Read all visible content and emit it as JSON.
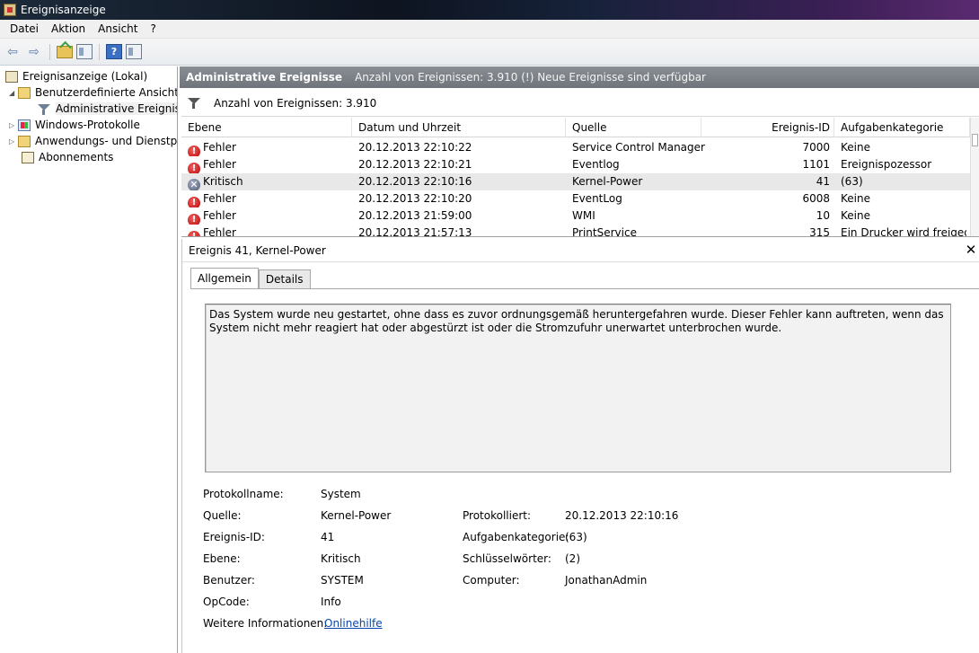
{
  "window": {
    "title": "Ereignisanzeige"
  },
  "menu": [
    "Datei",
    "Aktion",
    "Ansicht",
    "?"
  ],
  "tree": {
    "root": "Ereignisanzeige (Lokal)",
    "custom_views": "Benutzerdefinierte Ansichten",
    "admin_events": "Administrative Ereignisse",
    "windows_logs": "Windows-Protokolle",
    "app_logs": "Anwendungs- und Dienstprotokolle",
    "subscriptions": "Abonnements"
  },
  "header": {
    "title": "Administrative Ereignisse",
    "info": "Anzahl von Ereignissen: 3.910 (!) Neue Ereignisse sind verfügbar"
  },
  "filter": {
    "text": "Anzahl von Ereignissen: 3.910"
  },
  "columns": [
    "Ebene",
    "Datum und Uhrzeit",
    "Quelle",
    "Ereignis-ID",
    "Aufgabenkategorie"
  ],
  "events": [
    {
      "level": "Fehler",
      "icon": "error-icon",
      "datetime": "20.12.2013 22:10:22",
      "source": "Service Control Manager",
      "id": "7000",
      "category": "Keine"
    },
    {
      "level": "Fehler",
      "icon": "error-icon",
      "datetime": "20.12.2013 22:10:21",
      "source": "Eventlog",
      "id": "1101",
      "category": "Ereignispozessor"
    },
    {
      "level": "Kritisch",
      "icon": "critical-icon",
      "datetime": "20.12.2013 22:10:16",
      "source": "Kernel-Power",
      "id": "41",
      "category": "(63)"
    },
    {
      "level": "Fehler",
      "icon": "error-icon",
      "datetime": "20.12.2013 22:10:20",
      "source": "EventLog",
      "id": "6008",
      "category": "Keine"
    },
    {
      "level": "Fehler",
      "icon": "error-icon",
      "datetime": "20.12.2013 21:59:00",
      "source": "WMI",
      "id": "10",
      "category": "Keine"
    },
    {
      "level": "Fehler",
      "icon": "error-icon",
      "datetime": "20.12.2013 21:57:13",
      "source": "PrintService",
      "id": "315",
      "category": "Ein Drucker wird freigeg..."
    }
  ],
  "detail": {
    "title": "Ereignis 41, Kernel-Power",
    "tab_general": "Allgemein",
    "tab_details": "Details",
    "description": "Das System wurde neu gestartet, ohne dass es zuvor ordnungsgemäß heruntergefahren wurde. Dieser Fehler kann auftreten, wenn das System nicht mehr reagiert hat oder abgestürzt ist oder die Stromzufuhr unerwartet unterbrochen wurde.",
    "props": {
      "logname_label": "Protokollname:",
      "logname": "System",
      "source_label": "Quelle:",
      "source": "Kernel-Power",
      "logged_label": "Protokolliert:",
      "logged": "20.12.2013 22:10:16",
      "eventid_label": "Ereignis-ID:",
      "eventid": "41",
      "category_label": "Aufgabenkategorie:",
      "category": "(63)",
      "level_label": "Ebene:",
      "level": "Kritisch",
      "keywords_label": "Schlüsselwörter:",
      "keywords": "(2)",
      "user_label": "Benutzer:",
      "user": "SYSTEM",
      "computer_label": "Computer:",
      "computer": "JonathanAdmin",
      "opcode_label": "OpCode:",
      "opcode": "Info",
      "moreinfo_label": "Weitere Informationen:",
      "moreinfo": "Onlinehilfe"
    }
  }
}
